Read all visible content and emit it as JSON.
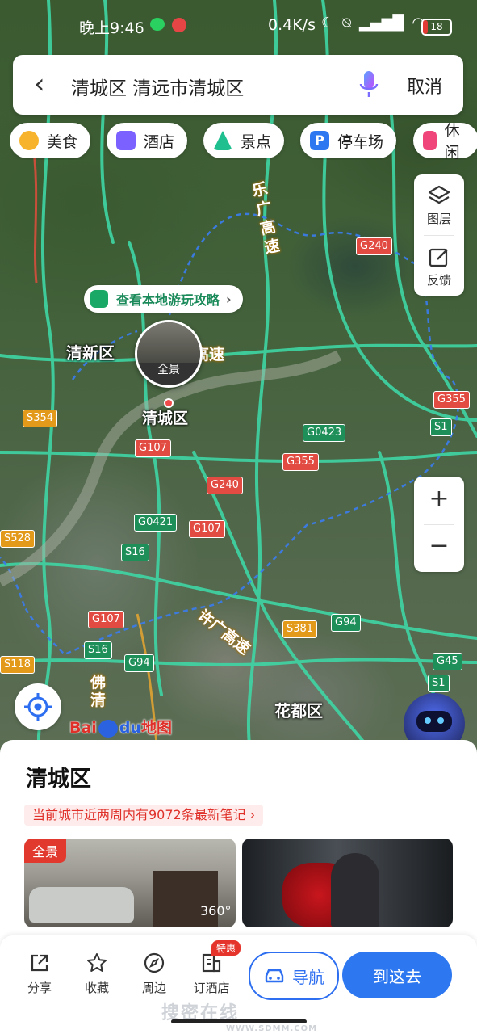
{
  "status_bar": {
    "time": "晚上9:46",
    "network_speed": "0.4K/s",
    "battery": "18",
    "battery_level": 0.18,
    "colors": {
      "battery_low": "#e23b35"
    }
  },
  "search": {
    "query": "清城区 清远市清城区",
    "cancel_label": "取消"
  },
  "categories": [
    {
      "label": "美食",
      "icon": "food-icon",
      "color": "#f7b32b"
    },
    {
      "label": "酒店",
      "icon": "hotel-icon",
      "color": "#7b61ff"
    },
    {
      "label": "景点",
      "icon": "scenic-icon",
      "color": "#1fbf8f"
    },
    {
      "label": "停车场",
      "icon": "parking-icon",
      "color": "#2d78f0"
    },
    {
      "label": "休闲",
      "icon": "leisure-icon",
      "color": "#f0457a"
    }
  ],
  "map_tools": {
    "layers_label": "图层",
    "feedback_label": "反馈",
    "zoom_in": "+",
    "zoom_out": "−"
  },
  "map": {
    "tip": "查看本地游玩攻略",
    "pano_label": "全景",
    "place_labels": [
      "清新区",
      "清城区",
      "花都区"
    ],
    "highway_labels": [
      "乐广高速",
      "高速",
      "许广高速",
      "佛清"
    ],
    "road_shields": [
      {
        "text": "G240",
        "type": "red"
      },
      {
        "text": "G355",
        "type": "red"
      },
      {
        "text": "S1",
        "type": "green"
      },
      {
        "text": "S354",
        "type": "orange"
      },
      {
        "text": "G0423",
        "type": "green"
      },
      {
        "text": "G107",
        "type": "red"
      },
      {
        "text": "G355",
        "type": "red"
      },
      {
        "text": "G240",
        "type": "red"
      },
      {
        "text": "G0421",
        "type": "green"
      },
      {
        "text": "G107",
        "type": "red"
      },
      {
        "text": "S528",
        "type": "orange"
      },
      {
        "text": "S16",
        "type": "green"
      },
      {
        "text": "G107",
        "type": "red"
      },
      {
        "text": "S381",
        "type": "orange"
      },
      {
        "text": "G94",
        "type": "green"
      },
      {
        "text": "S16",
        "type": "green"
      },
      {
        "text": "G94",
        "type": "green"
      },
      {
        "text": "S118",
        "type": "orange"
      },
      {
        "text": "G45",
        "type": "green"
      },
      {
        "text": "S1",
        "type": "green"
      }
    ],
    "brand_prefix": "Bai",
    "brand_mid": "du",
    "brand_suffix": "地图"
  },
  "panel": {
    "title": "清城区",
    "notes_banner": "当前城市近两周内有9072条最新笔记 ›",
    "photo1_tag": "全景",
    "photo1_badge": "360°"
  },
  "bottom_bar": {
    "share": "分享",
    "favorite": "收藏",
    "nearby": "周边",
    "book_hotel": "订酒店",
    "special_badge": "特惠",
    "navigate": "导航",
    "go_there": "到这去"
  },
  "watermark": {
    "text": "搜密在线",
    "url": "WWW.SDMM.COM"
  }
}
